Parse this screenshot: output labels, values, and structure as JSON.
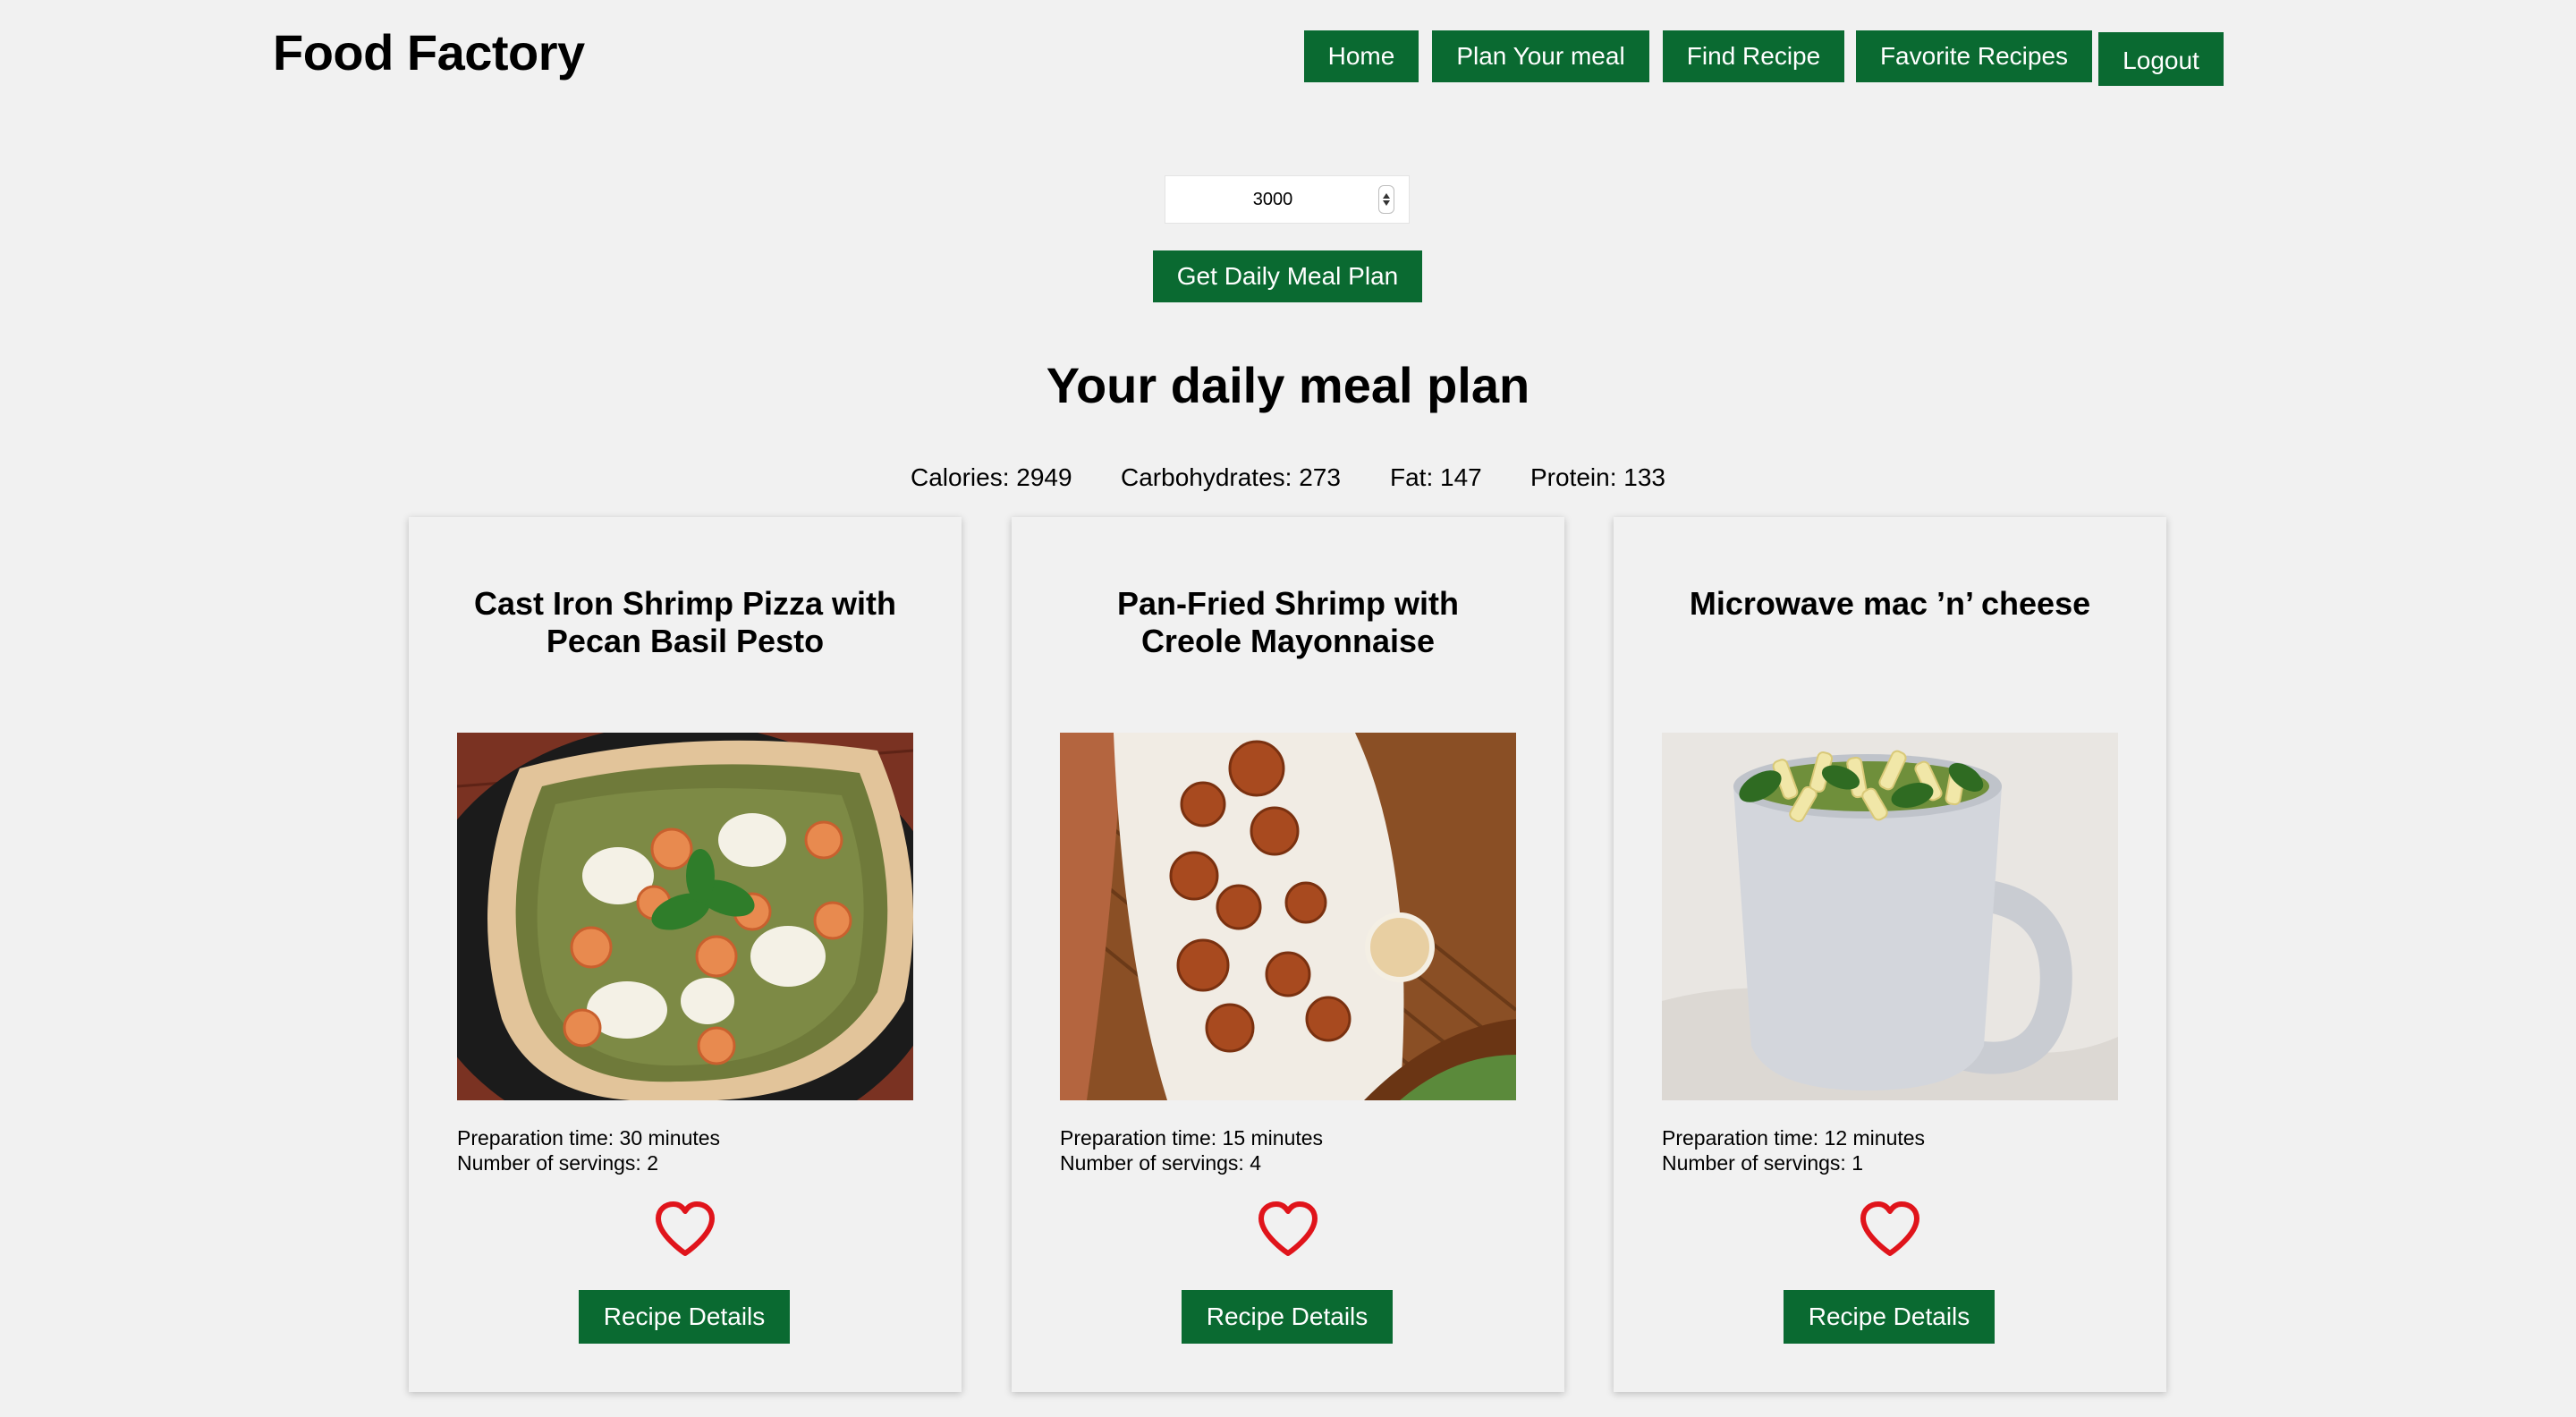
{
  "header": {
    "brand": "Food Factory",
    "nav": [
      {
        "label": "Home"
      },
      {
        "label": "Plan Your meal"
      },
      {
        "label": "Find Recipe"
      },
      {
        "label": "Favorite Recipes"
      },
      {
        "label": "Logout"
      }
    ]
  },
  "planner": {
    "calories_value": "3000",
    "button_label": "Get Daily Meal Plan"
  },
  "plan": {
    "title": "Your daily meal plan",
    "nutrients": {
      "calories": "Calories: 2949",
      "carbohydrates": "Carbohydrates: 273",
      "fat": "Fat: 147",
      "protein": "Protein: 133"
    }
  },
  "recipes": [
    {
      "title_line1": "Cast Iron Shrimp Pizza with",
      "title_line2": "Pecan Basil Pesto",
      "prep": "Preparation time: 30 minutes",
      "servings": "Number of servings: 2",
      "details_label": "Recipe Details"
    },
    {
      "title_line1": "Pan-Fried Shrimp with",
      "title_line2": "Creole Mayonnaise",
      "prep": "Preparation time: 15 minutes",
      "servings": "Number of servings: 4",
      "details_label": "Recipe Details"
    },
    {
      "title_line1": "Microwave mac ’n’ cheese",
      "title_line2": "",
      "prep": "Preparation time: 12 minutes",
      "servings": "Number of servings: 1",
      "details_label": "Recipe Details"
    }
  ],
  "colors": {
    "accent": "#0a6a31",
    "background": "#f1f1f1",
    "heart": "#e0141b"
  },
  "icons": {
    "favorite": "heart-outline-icon",
    "stepper": "number-stepper-icon"
  }
}
